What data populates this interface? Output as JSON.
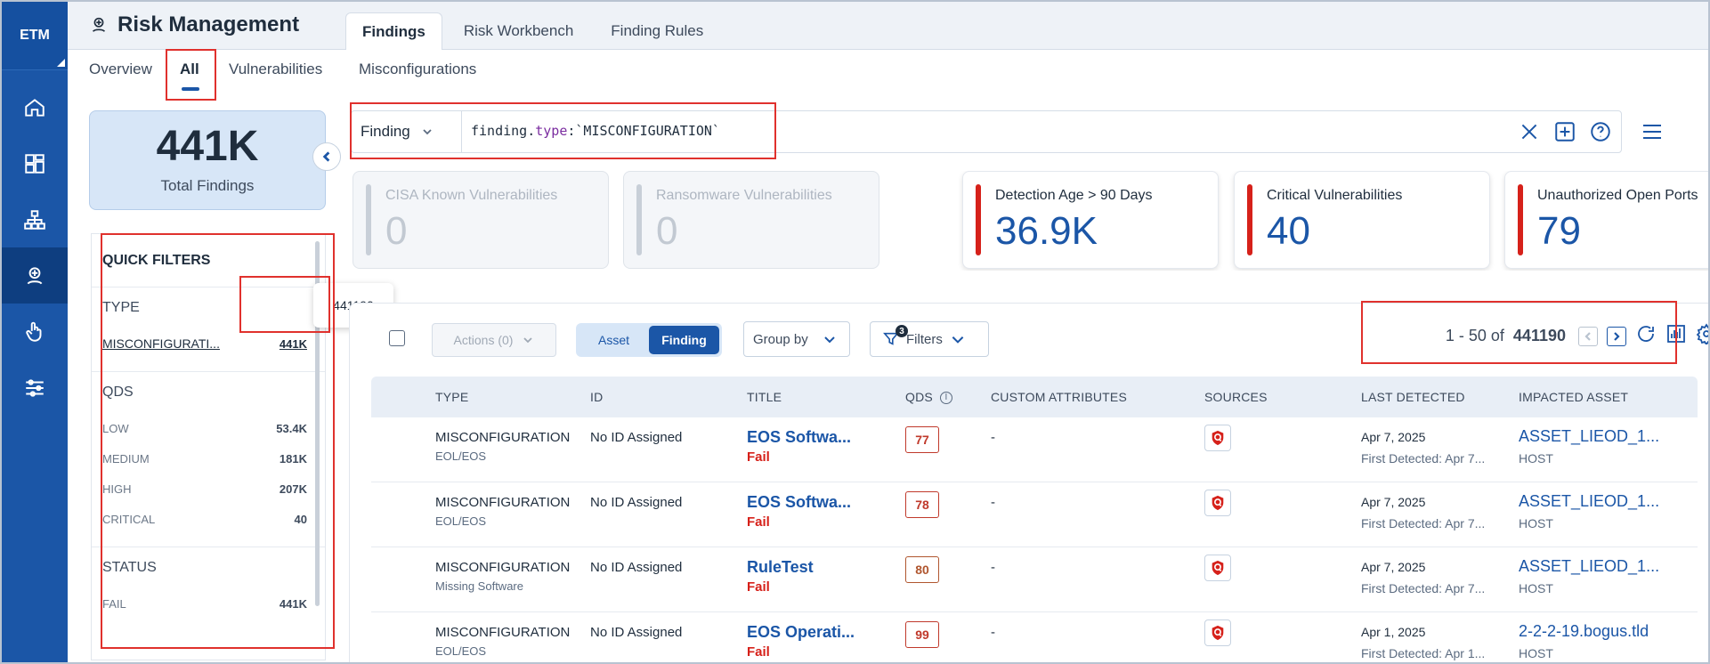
{
  "rail": {
    "logo": "ETM",
    "items": [
      {
        "icon": "home-icon"
      },
      {
        "icon": "dashboard-icon"
      },
      {
        "icon": "network-icon"
      },
      {
        "icon": "risk-icon",
        "active": true
      },
      {
        "icon": "hand-pointer-icon"
      },
      {
        "icon": "sliders-icon"
      }
    ]
  },
  "header": {
    "title": "Risk Management",
    "tabs": [
      {
        "label": "Findings",
        "active": true
      },
      {
        "label": "Risk Workbench"
      },
      {
        "label": "Finding Rules"
      }
    ]
  },
  "subnav": {
    "tabs": [
      {
        "label": "Overview"
      },
      {
        "label": "All",
        "active": true
      },
      {
        "label": "Vulnerabilities"
      },
      {
        "label": "Misconfigurations"
      }
    ]
  },
  "total": {
    "value": "441K",
    "label": "Total Findings"
  },
  "quick_filters": {
    "title": "QUICK FILTERS",
    "tooltip": "441190",
    "type": {
      "title": "TYPE",
      "rows": [
        {
          "label": "MISCONFIGURATI...",
          "value": "441K"
        }
      ]
    },
    "qds": {
      "title": "QDS",
      "rows": [
        {
          "label": "LOW",
          "value": "53.4K"
        },
        {
          "label": "MEDIUM",
          "value": "181K"
        },
        {
          "label": "HIGH",
          "value": "207K"
        },
        {
          "label": "CRITICAL",
          "value": "40"
        }
      ]
    },
    "status": {
      "title": "STATUS",
      "rows": [
        {
          "label": "FAIL",
          "value": "441K"
        }
      ]
    }
  },
  "query": {
    "selector": "Finding",
    "prefix": "finding.",
    "keyword": "type",
    "suffix": ":`MISCONFIGURATION`"
  },
  "metrics": [
    {
      "title": "CISA Known Vulnerabilities",
      "value": "0",
      "state": "disabled"
    },
    {
      "title": "Ransomware Vulnerabilities",
      "value": "0",
      "state": "disabled"
    },
    {
      "title": "Detection Age > 90 Days",
      "value": "36.9K",
      "state": "enabled"
    },
    {
      "title": "Critical Vulnerabilities",
      "value": "40",
      "state": "enabled"
    },
    {
      "title": "Unauthorized Open Ports",
      "value": "79",
      "state": "enabled"
    }
  ],
  "toolbar": {
    "actions": "Actions (0)",
    "segment": [
      "Asset",
      "Finding"
    ],
    "group_by": "Group by",
    "filters": "Filters",
    "filters_count": "3",
    "range": "1 - 50 of",
    "total": "441190"
  },
  "table": {
    "columns": [
      "TYPE",
      "ID",
      "TITLE",
      "QDS",
      "CUSTOM ATTRIBUTES",
      "SOURCES",
      "LAST DETECTED",
      "IMPACTED ASSET"
    ],
    "rows": [
      {
        "type": "MISCONFIGURATION",
        "subtype": "EOL/EOS",
        "id": "No ID Assigned",
        "title": "EOS Softwa...",
        "status": "Fail",
        "qds": "77",
        "custom": "-",
        "last": "Apr 7, 2025",
        "first": "First Detected: Apr 7...",
        "asset": "ASSET_LIEOD_1...",
        "asset_type": "HOST"
      },
      {
        "type": "MISCONFIGURATION",
        "subtype": "EOL/EOS",
        "id": "No ID Assigned",
        "title": "EOS Softwa...",
        "status": "Fail",
        "qds": "78",
        "custom": "-",
        "last": "Apr 7, 2025",
        "first": "First Detected: Apr 7...",
        "asset": "ASSET_LIEOD_1...",
        "asset_type": "HOST"
      },
      {
        "type": "MISCONFIGURATION",
        "subtype": "Missing Software",
        "id": "No ID Assigned",
        "title": "RuleTest",
        "status": "Fail",
        "qds": "80",
        "custom": "-",
        "last": "Apr 7, 2025",
        "first": "First Detected: Apr 7...",
        "asset": "ASSET_LIEOD_1...",
        "asset_type": "HOST"
      },
      {
        "type": "MISCONFIGURATION",
        "subtype": "EOL/EOS",
        "id": "No ID Assigned",
        "title": "EOS Operati...",
        "status": "Fail",
        "qds": "99",
        "custom": "-",
        "last": "Apr 1, 2025",
        "first": "First Detected: Apr 1...",
        "asset": "2-2-2-19.bogus.tld",
        "asset_type": "HOST"
      }
    ]
  },
  "colors": {
    "accent": "#1b56a7",
    "critical": "#d6211a",
    "highlight": "#e0312d"
  }
}
